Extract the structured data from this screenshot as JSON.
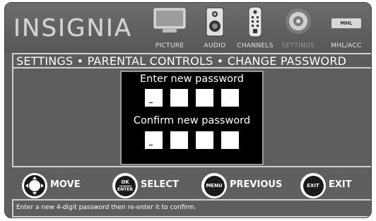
{
  "brand": {
    "logo_text": "INSIGNIA"
  },
  "menu": {
    "items": [
      {
        "label": "PICTURE",
        "icon": "tv-icon",
        "active": false
      },
      {
        "label": "AUDIO",
        "icon": "speaker-icon",
        "active": false
      },
      {
        "label": "CHANNELS",
        "icon": "remote-icon",
        "active": false
      },
      {
        "label": "SETTINGS",
        "icon": "gear-icon",
        "active": true
      },
      {
        "label": "MHL/ACC",
        "icon": "mhl-icon",
        "active": false
      }
    ],
    "mhl_badge": "MHL"
  },
  "breadcrumb": {
    "text": "SETTINGS • PARENTAL CONTROLS • CHANGE PASSWORD"
  },
  "dialog": {
    "enter_label": "Enter new password",
    "confirm_label": "Confirm new password",
    "cursor_char": "_"
  },
  "controls": {
    "move": {
      "label": "MOVE"
    },
    "select": {
      "label": "SELECT",
      "key_top": "OK",
      "key_bottom": "ENTER"
    },
    "previous": {
      "label": "PREVIOUS",
      "key": "MENU"
    },
    "exit": {
      "label": "EXIT",
      "key": "EXIT"
    }
  },
  "help_text": "Enter a new 4-digit password then re-enter it to confirm.",
  "colors": {
    "panel": "#5e5e5e",
    "dialog_bg": "#000000",
    "border": "#cfcfcf"
  }
}
